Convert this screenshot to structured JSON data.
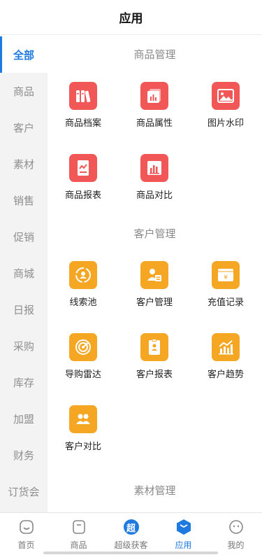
{
  "header": {
    "title": "应用"
  },
  "sidebar": {
    "items": [
      {
        "label": "全部",
        "active": true
      },
      {
        "label": "商品"
      },
      {
        "label": "客户"
      },
      {
        "label": "素材"
      },
      {
        "label": "销售"
      },
      {
        "label": "促销"
      },
      {
        "label": "商城"
      },
      {
        "label": "日报"
      },
      {
        "label": "采购"
      },
      {
        "label": "库存"
      },
      {
        "label": "加盟"
      },
      {
        "label": "财务"
      },
      {
        "label": "订货会"
      }
    ]
  },
  "sections": [
    {
      "title": "商品管理",
      "color": "#f25757",
      "apps": [
        {
          "label": "商品档案",
          "icon": "book-stack-icon"
        },
        {
          "label": "商品属性",
          "icon": "bar-card-icon"
        },
        {
          "label": "图片水印",
          "icon": "image-icon"
        },
        {
          "label": "商品报表",
          "icon": "report-icon"
        },
        {
          "label": "商品对比",
          "icon": "bar-chart-icon"
        }
      ]
    },
    {
      "title": "客户管理",
      "color": "#f5a623",
      "apps": [
        {
          "label": "线索池",
          "icon": "person-circle-icon"
        },
        {
          "label": "客户管理",
          "icon": "person-card-icon"
        },
        {
          "label": "充值记录",
          "icon": "yen-card-icon"
        },
        {
          "label": "导购雷达",
          "icon": "radar-icon"
        },
        {
          "label": "客户报表",
          "icon": "badge-icon"
        },
        {
          "label": "客户趋势",
          "icon": "trend-chart-icon"
        },
        {
          "label": "客户对比",
          "icon": "group-icon"
        }
      ]
    },
    {
      "title": "素材管理",
      "color": "#4ab3ee",
      "apps": []
    }
  ],
  "tabbar": {
    "items": [
      {
        "label": "首页",
        "icon": "home-icon"
      },
      {
        "label": "商品",
        "icon": "bag-icon"
      },
      {
        "label": "超级获客",
        "icon": "super-icon",
        "glyph": "超"
      },
      {
        "label": "应用",
        "icon": "apps-cube-icon",
        "active": true
      },
      {
        "label": "我的",
        "icon": "profile-icon"
      }
    ]
  },
  "colors": {
    "accent": "#1f7ae0",
    "product": "#f25757",
    "customer": "#f5a623",
    "material": "#4ab3ee"
  }
}
